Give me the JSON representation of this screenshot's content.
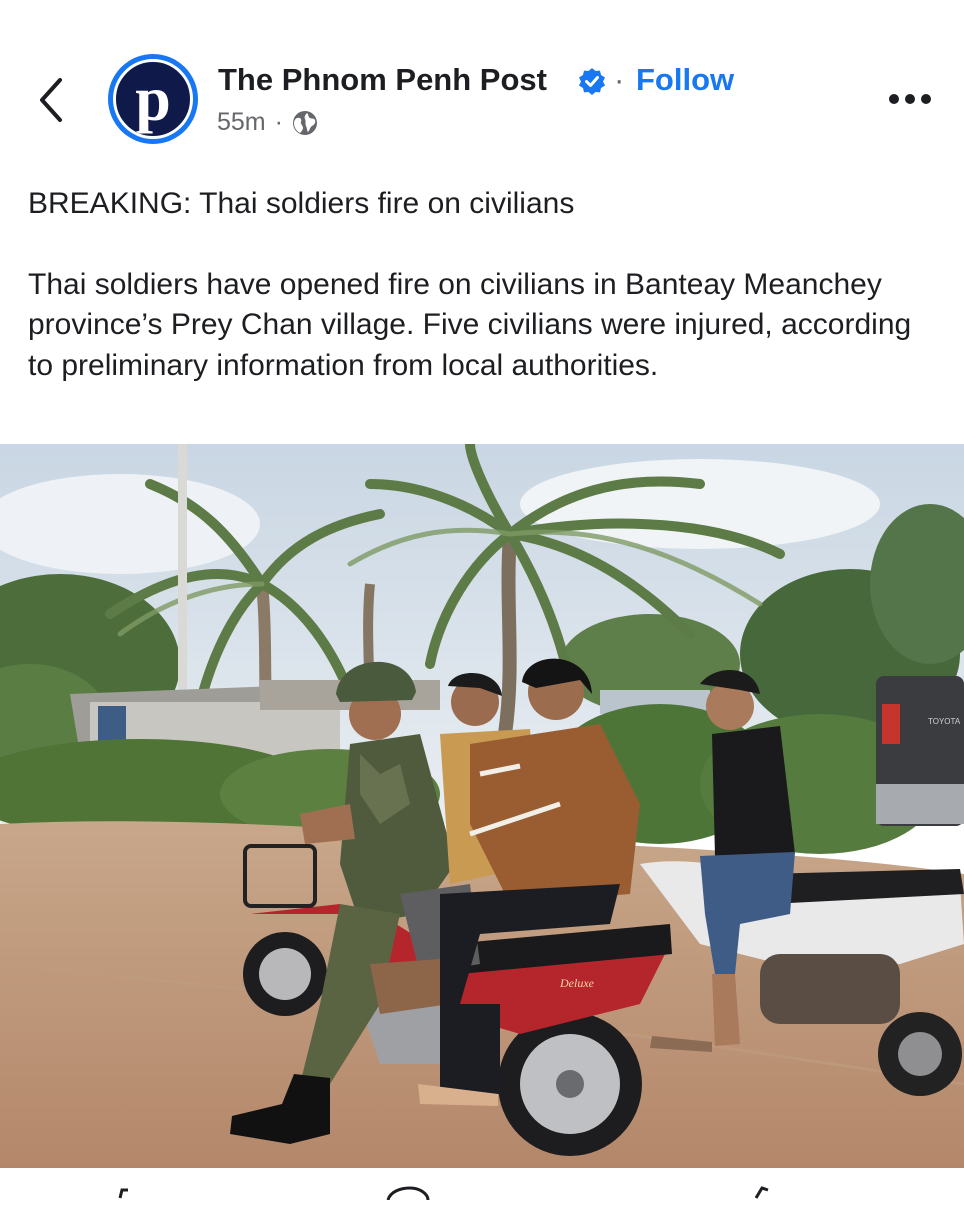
{
  "header": {
    "page_name": "The Phnom Penh Post",
    "follow_label": "Follow",
    "separator": "·",
    "time": "55m",
    "meta_separator": "·",
    "avatar_letter": "p"
  },
  "post": {
    "headline": "BREAKING: Thai soldiers fire on civilians",
    "body": "Thai soldiers have opened fire on civilians in Banteay Meanchey province’s Prey Chan village. Five civilians were injured, according to preliminary information from local authorities."
  },
  "photo": {
    "truck_badge": "TOYOTA",
    "bike_badge": "Deluxe"
  },
  "icons": {
    "back": "chevron-left-icon",
    "verified": "verified-badge-icon",
    "audience": "globe-icon",
    "more": "more-horizontal-icon"
  },
  "colors": {
    "accent": "#1877f2",
    "text": "#1c1e21",
    "secondary_text": "#65676b",
    "avatar_bg": "#0f1a4a"
  }
}
